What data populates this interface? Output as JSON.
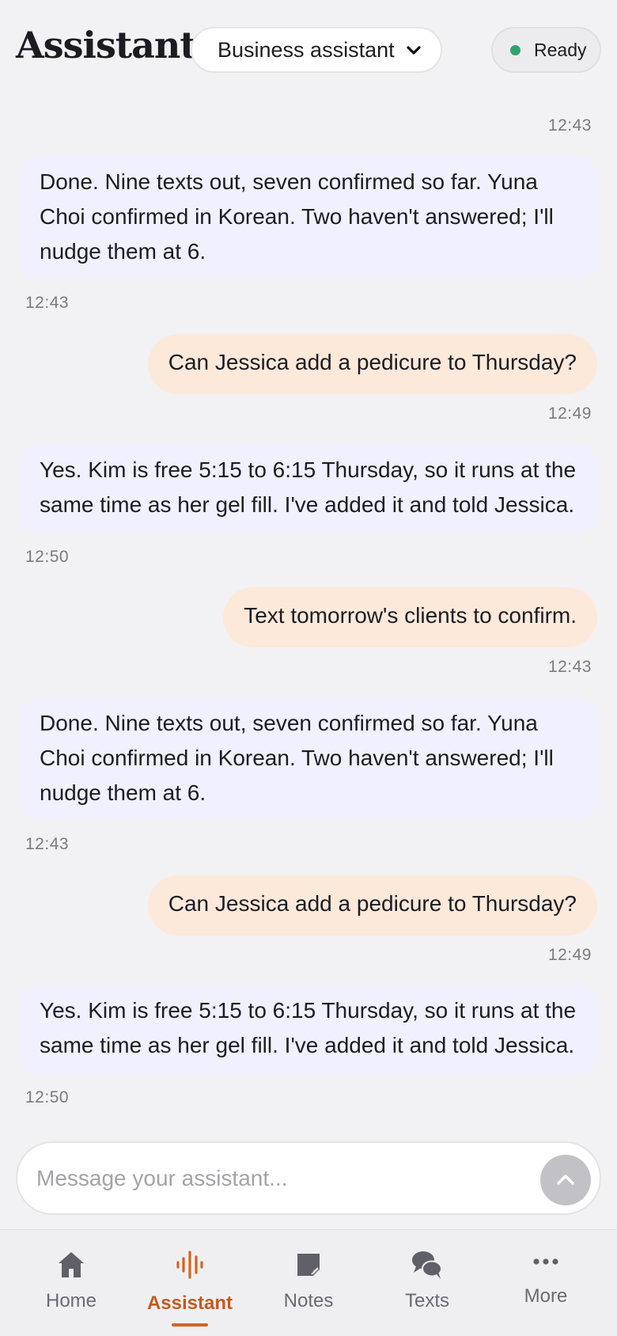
{
  "header": {
    "title": "Assistant",
    "mode_selected": "Business assistant",
    "status_label": "Ready",
    "status_color": "#2fa36b"
  },
  "messages": [
    {
      "role": "user",
      "text": "",
      "time": "12:43",
      "partial": true
    },
    {
      "role": "assistant",
      "lines": [
        "Done. Nine texts out, seven confirmed so far. Yuna",
        "Choi confirmed in Korean. Two haven't answered; I'll",
        "nudge them at 6."
      ],
      "time": "12:43"
    },
    {
      "role": "user",
      "text": "Can Jessica add a pedicure to Thursday?",
      "time": "12:49"
    },
    {
      "role": "assistant",
      "lines": [
        "Yes. Kim is free 5:15 to 6:15 Thursday, so it runs at the",
        "same time as her gel fill. I've added it and told Jessica."
      ],
      "time": "12:50"
    },
    {
      "role": "user",
      "text": "Text tomorrow's clients to confirm.",
      "time": "12:43"
    },
    {
      "role": "assistant",
      "lines": [
        "Done. Nine texts out, seven confirmed so far. Yuna",
        "Choi confirmed in Korean. Two haven't answered; I'll",
        "nudge them at 6."
      ],
      "time": "12:43"
    },
    {
      "role": "user",
      "text": "Can Jessica add a pedicure to Thursday?",
      "time": "12:49"
    },
    {
      "role": "assistant",
      "lines": [
        "Yes. Kim is free 5:15 to 6:15 Thursday, so it runs at the",
        "same time as her gel fill. I've added it and told Jessica."
      ],
      "time": "12:50"
    }
  ],
  "composer": {
    "placeholder": "Message your assistant...",
    "value": ""
  },
  "nav": {
    "items": [
      {
        "label": "Home",
        "icon": "home-icon"
      },
      {
        "label": "Assistant",
        "icon": "waveform-icon",
        "active": true
      },
      {
        "label": "Notes",
        "icon": "note-icon"
      },
      {
        "label": "Texts",
        "icon": "chat-bubbles-icon"
      },
      {
        "label": "More",
        "icon": "more-dots-icon"
      }
    ],
    "accent": "#d2651e"
  },
  "colors": {
    "user_bubble": "#fce9da",
    "assistant_bubble": "#f0f0ff",
    "background": "#f2f2f5"
  }
}
